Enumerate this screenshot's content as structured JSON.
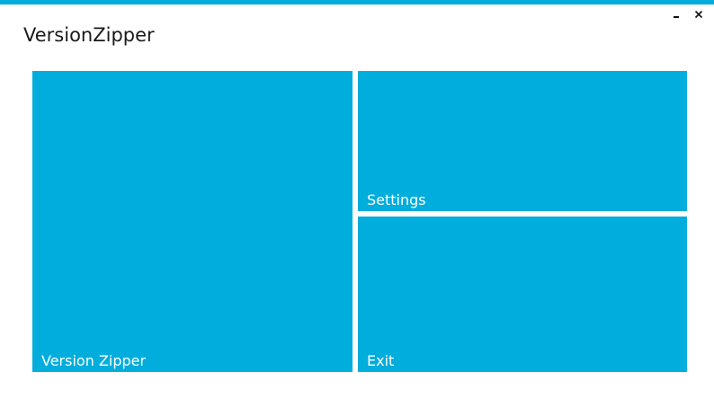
{
  "window": {
    "title": "VersionZipper",
    "accent_color": "#00ADDC",
    "minimize_icon": "minimize-icon",
    "close_icon": "close-icon"
  },
  "tiles": [
    {
      "label": "Version Zipper"
    },
    {
      "label": "Settings"
    },
    {
      "label": "Exit"
    }
  ]
}
